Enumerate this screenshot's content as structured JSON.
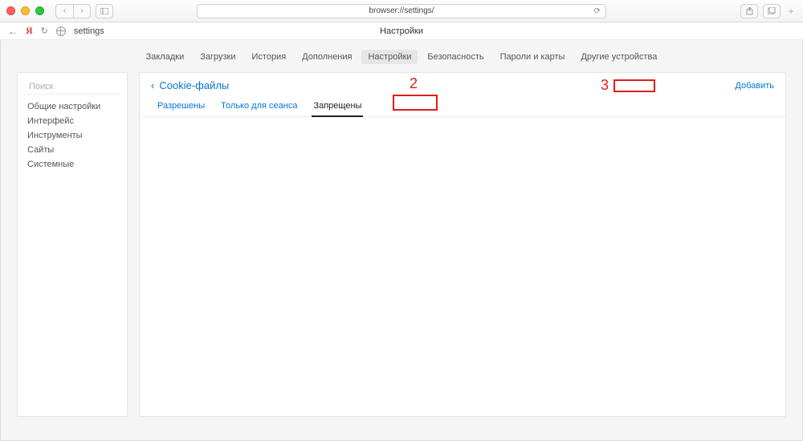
{
  "address_bar": {
    "url": "browser://settings/"
  },
  "tab": {
    "title": "settings"
  },
  "page_title": "Настройки",
  "topnav": {
    "items": [
      {
        "label": "Закладки"
      },
      {
        "label": "Загрузки"
      },
      {
        "label": "История"
      },
      {
        "label": "Дополнения"
      },
      {
        "label": "Настройки"
      },
      {
        "label": "Безопасность"
      },
      {
        "label": "Пароли и карты"
      },
      {
        "label": "Другие устройства"
      }
    ],
    "active_index": 4
  },
  "sidebar": {
    "search_placeholder": "Поиск",
    "items": [
      {
        "label": "Общие настройки"
      },
      {
        "label": "Интерфейс"
      },
      {
        "label": "Инструменты"
      },
      {
        "label": "Сайты"
      },
      {
        "label": "Системные"
      }
    ]
  },
  "panel": {
    "breadcrumb_label": "Cookie-файлы",
    "add_label": "Добавить",
    "subtabs": [
      {
        "label": "Разрешены"
      },
      {
        "label": "Только для сеанса"
      },
      {
        "label": "Запрещены"
      }
    ],
    "active_subtab_index": 2
  },
  "annotations": {
    "two": "2",
    "three": "3"
  }
}
